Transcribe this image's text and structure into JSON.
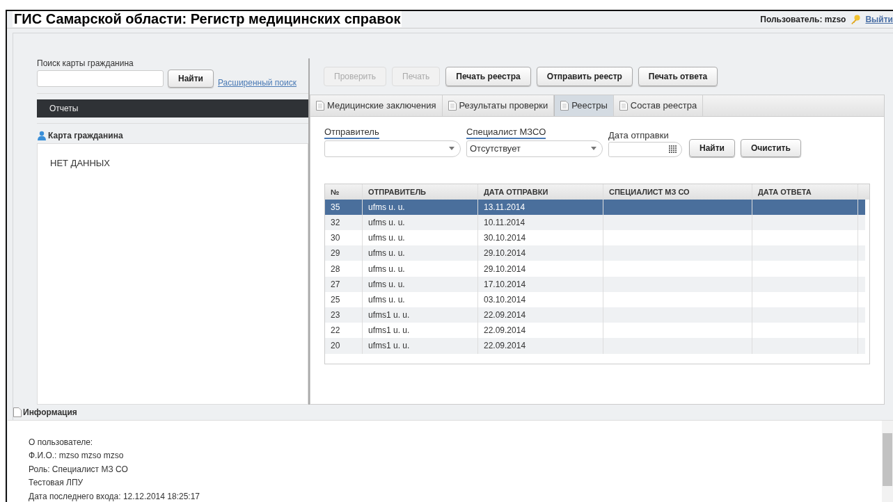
{
  "header": {
    "title": "ГИС Самарской области: Регистр медицинских справок",
    "user": "Пользователь: mzso",
    "logout": "Выйти"
  },
  "search": {
    "label": "Поиск карты гражданина",
    "button": "Найти",
    "advanced_link": "Расширенный поиск"
  },
  "reports_bar": "Отчеты",
  "citizen_card": {
    "title": "Карта гражданина",
    "empty": "НЕТ ДАННЫХ"
  },
  "toolbar": [
    {
      "label": "Проверить",
      "disabled": true
    },
    {
      "label": "Печать",
      "disabled": true
    },
    {
      "label": "Печать реестра",
      "disabled": false
    },
    {
      "label": "Отправить реестр",
      "disabled": false
    },
    {
      "label": "Печать ответа",
      "disabled": false
    }
  ],
  "tabs": [
    {
      "label": "Медицинские заключения",
      "selected": false
    },
    {
      "label": "Результаты проверки",
      "selected": false
    },
    {
      "label": "Реестры",
      "selected": true
    },
    {
      "label": "Состав реестра",
      "selected": false
    }
  ],
  "filters": {
    "sender_label": "Отправитель",
    "specialist_label": "Специалист МЗСО",
    "specialist_value": "Отсутствует",
    "date_label": "Дата отправки",
    "find_button": "Найти",
    "clear_button": "Очистить"
  },
  "table": {
    "columns": [
      "№",
      "ОТПРАВИТЕЛЬ",
      "ДАТА ОТПРАВКИ",
      "СПЕЦИАЛИСТ МЗ СО",
      "ДАТА ОТВЕТА"
    ],
    "rows": [
      {
        "cells": [
          "35",
          "ufms u. u.",
          "13.11.2014"
        ],
        "selected": true
      },
      {
        "cells": [
          "32",
          "ufms u. u.",
          "10.11.2014"
        ],
        "selected": false
      },
      {
        "cells": [
          "30",
          "ufms u. u.",
          "30.10.2014"
        ],
        "selected": false
      },
      {
        "cells": [
          "29",
          "ufms u. u.",
          "29.10.2014"
        ],
        "selected": false
      },
      {
        "cells": [
          "28",
          "ufms u. u.",
          "29.10.2014"
        ],
        "selected": false
      },
      {
        "cells": [
          "27",
          "ufms u. u.",
          "17.10.2014"
        ],
        "selected": false
      },
      {
        "cells": [
          "25",
          "ufms u. u.",
          "03.10.2014"
        ],
        "selected": false
      },
      {
        "cells": [
          "23",
          "ufms1 u. u.",
          "22.09.2014"
        ],
        "selected": false
      },
      {
        "cells": [
          "22",
          "ufms1 u. u.",
          "22.09.2014"
        ],
        "selected": false
      },
      {
        "cells": [
          "20",
          "ufms1 u. u.",
          "22.09.2014"
        ],
        "selected": false
      }
    ]
  },
  "info": {
    "title": "Информация",
    "lines": [
      "О пользователе:",
      "Ф.И.О.: mzso mzso mzso",
      "Роль: Специалист МЗ СО",
      "Тестовая ЛПУ",
      "Дата последнего входа: 12.12.2014 18:25:17"
    ]
  }
}
